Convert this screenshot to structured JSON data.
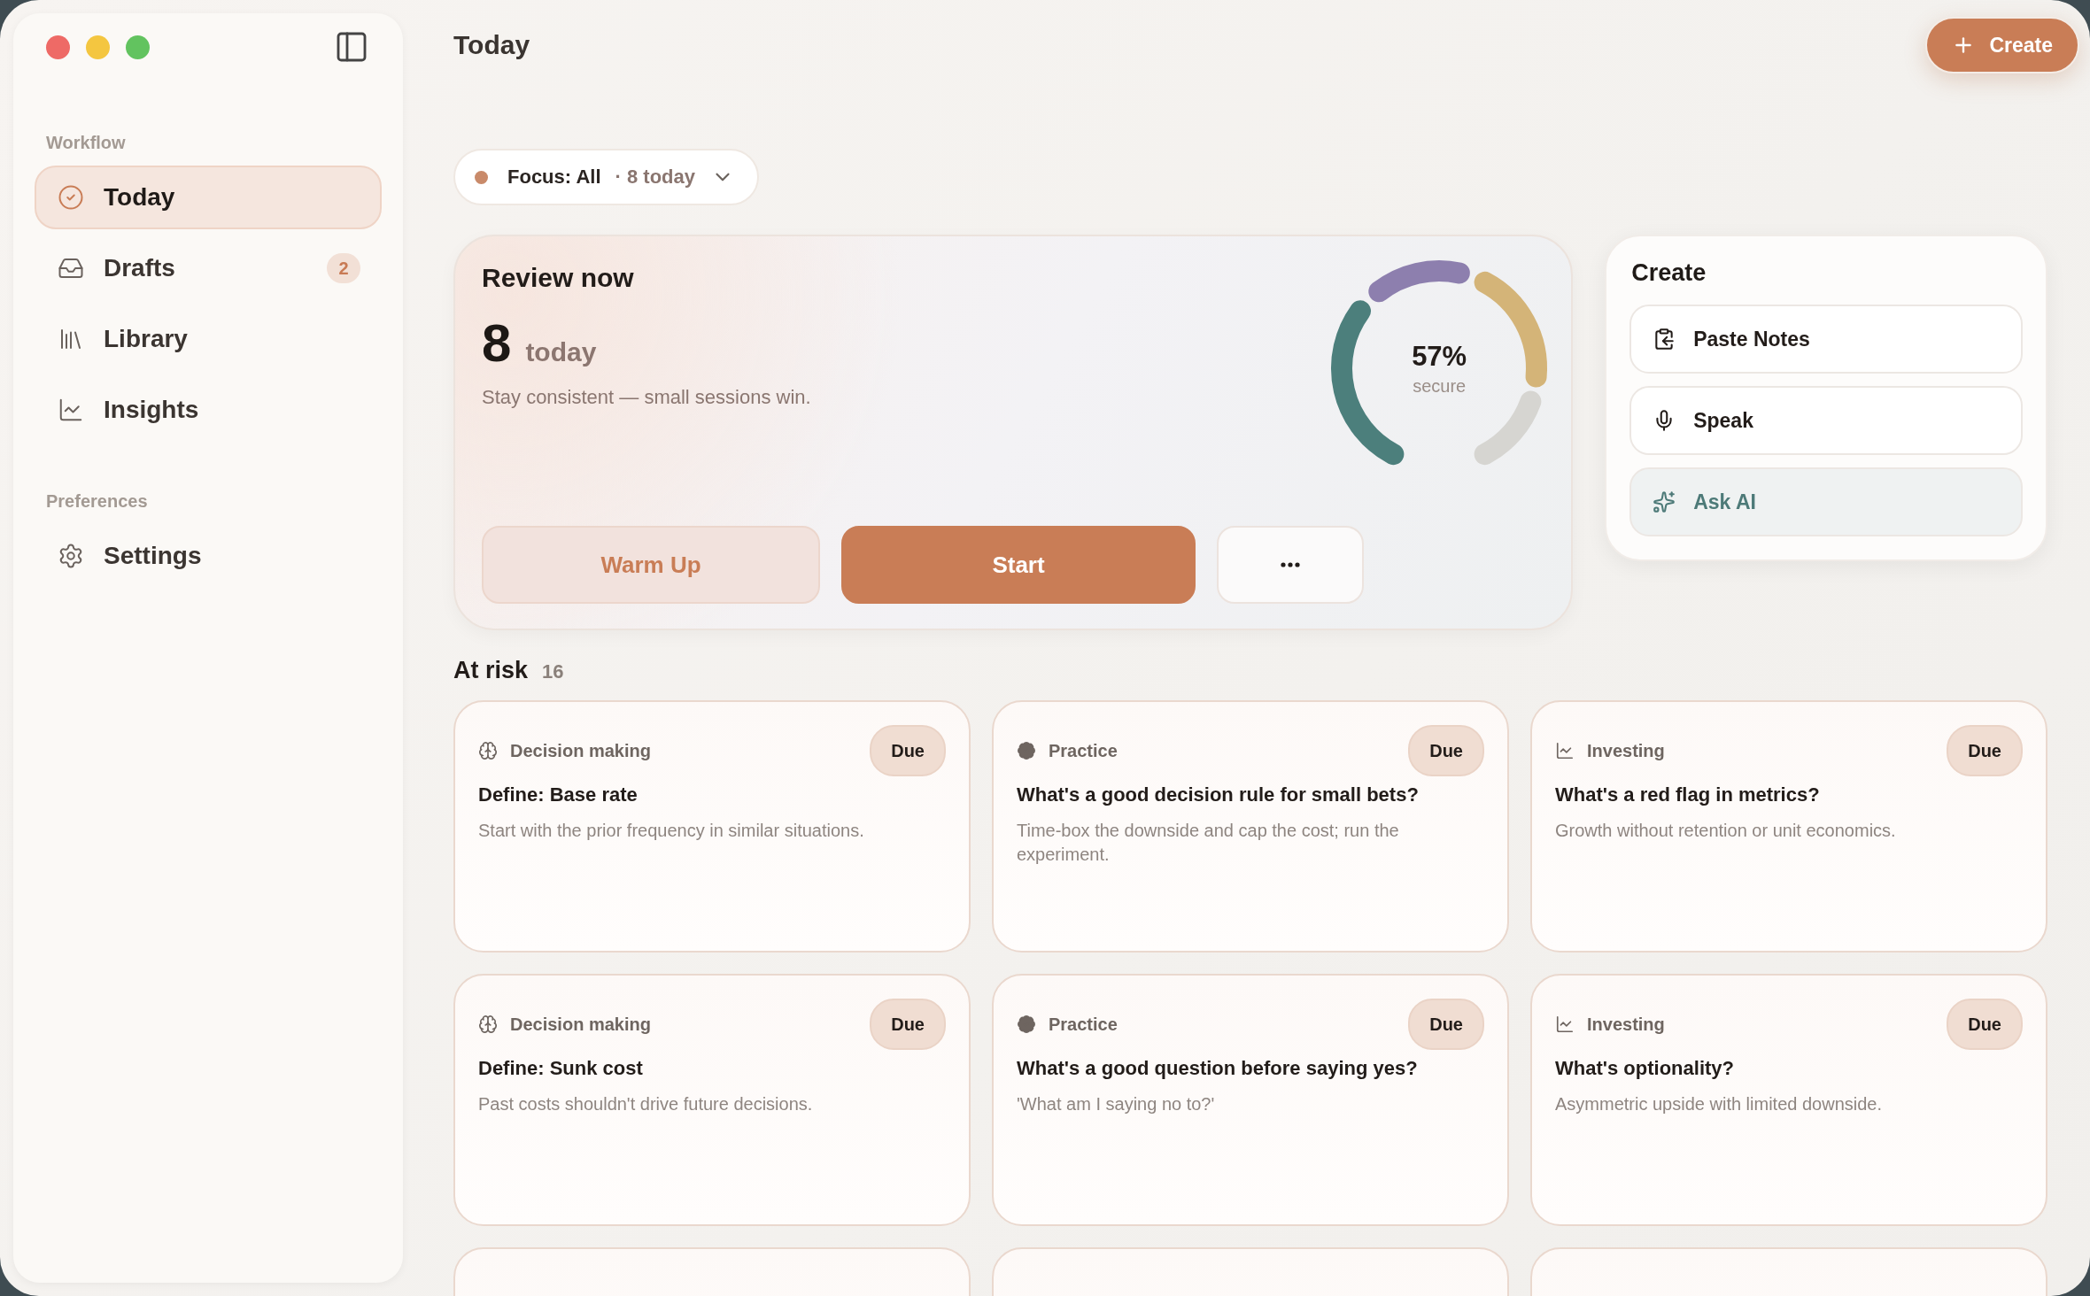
{
  "window": {
    "title": "Today"
  },
  "create_button": {
    "label": "Create"
  },
  "sidebar": {
    "sections": [
      {
        "label": "Workflow",
        "items": [
          {
            "label": "Today",
            "kind": "today",
            "selected": true
          },
          {
            "label": "Drafts",
            "kind": "drafts",
            "selected": false,
            "badge": "2"
          },
          {
            "label": "Library",
            "kind": "library",
            "selected": false
          },
          {
            "label": "Insights",
            "kind": "insights",
            "selected": false
          }
        ]
      },
      {
        "label": "Preferences",
        "items": [
          {
            "label": "Settings",
            "kind": "settings",
            "selected": false
          }
        ]
      }
    ]
  },
  "focus": {
    "label": "Focus: All",
    "count": "· 8 today",
    "color": "#c98a6a"
  },
  "review": {
    "title": "Review now",
    "count": "8",
    "unit": "today",
    "subtitle": "Stay consistent — small sessions win.",
    "percent": "57%",
    "percent_label": "secure",
    "buttons": [
      {
        "label": "Warm Up",
        "kind": "soft"
      },
      {
        "label": "Start",
        "kind": "primary"
      },
      {
        "kind": "more"
      }
    ]
  },
  "create_panel": {
    "title": "Create",
    "actions": [
      {
        "label": "Paste Notes",
        "kind": "paste"
      },
      {
        "label": "Speak",
        "kind": "speak"
      },
      {
        "label": "Ask AI",
        "kind": "ai"
      }
    ]
  },
  "at_risk": {
    "title": "At risk",
    "count": "16",
    "cards": [
      {
        "kind": "decision",
        "category": "Decision making",
        "badge": "Due",
        "title": "Define: Base rate",
        "body": "Start with the prior frequency in similar situations."
      },
      {
        "kind": "practice",
        "category": "Practice",
        "badge": "Due",
        "title": "What's a good decision rule for small bets?",
        "body": "Time-box the downside and cap the cost; run the experiment."
      },
      {
        "kind": "investing",
        "category": "Investing",
        "badge": "Due",
        "title": "What's a red flag in metrics?",
        "body": "Growth without retention or unit economics."
      },
      {
        "kind": "decision",
        "category": "Decision making",
        "badge": "Due",
        "title": "Define: Sunk cost",
        "body": "Past costs shouldn't drive future decisions."
      },
      {
        "kind": "practice",
        "category": "Practice",
        "badge": "Due",
        "title": "What's a good question before saying yes?",
        "body": "'What am I saying no to?'"
      },
      {
        "kind": "investing",
        "category": "Investing",
        "badge": "Due",
        "title": "What's optionality?",
        "body": "Asymmetric upside with limited downside."
      },
      {
        "kind": "clipped"
      },
      {
        "kind": "clipped"
      },
      {
        "kind": "clipped"
      }
    ]
  }
}
